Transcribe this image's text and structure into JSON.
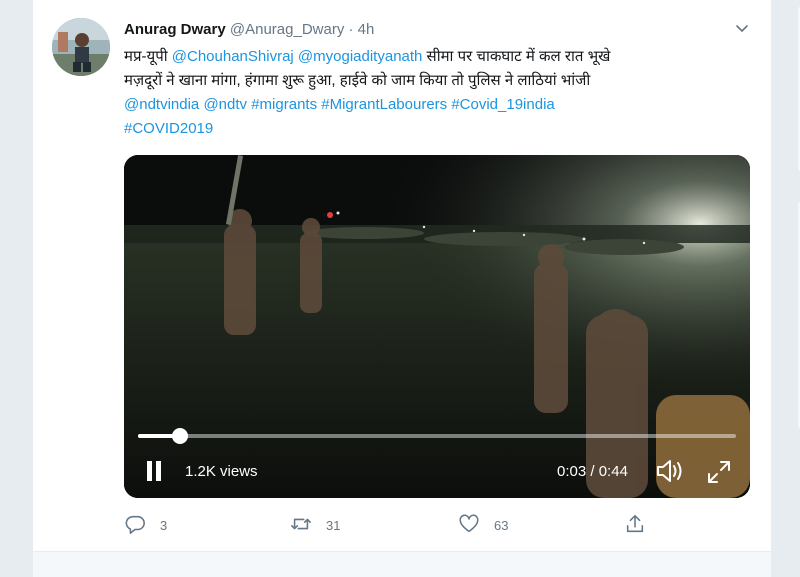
{
  "tweet": {
    "display_name": "Anurag Dwary",
    "handle": "@Anurag_Dwary",
    "separator": "·",
    "time": "4h",
    "text_line1_prefix": "मप्र-यूपी ",
    "mention1": "@ChouhanShivraj",
    "mention2": "@myogiadityanath",
    "text_line1_suffix": " सीमा पर चाकघाट में कल रात भूखे",
    "text_line2": "मज़दूरों ने खाना मांगा, हंगामा शुरू हुआ, हाईवे को जाम किया तो पुलिस ने लाठियां भांजी",
    "mention3": "@ndtvindia",
    "mention4": "@ndtv",
    "hashtag1": "#migrants",
    "hashtag2": "#MigrantLabourers",
    "hashtag3": "#Covid_19india",
    "hashtag4": "#COVID2019"
  },
  "video": {
    "views": "1.2K views",
    "current_time": "0:03",
    "duration": "0:44",
    "time_separator": " / ",
    "progress": 0.07
  },
  "actions": {
    "reply_count": "3",
    "retweet_count": "31",
    "like_count": "63"
  },
  "colors": {
    "link": "#1b95e0",
    "muted": "#657786",
    "text": "#14171a"
  },
  "icons": [
    "chevron-down-icon",
    "pause-icon",
    "volume-icon",
    "fullscreen-icon",
    "reply-icon",
    "retweet-icon",
    "like-icon",
    "share-icon"
  ]
}
